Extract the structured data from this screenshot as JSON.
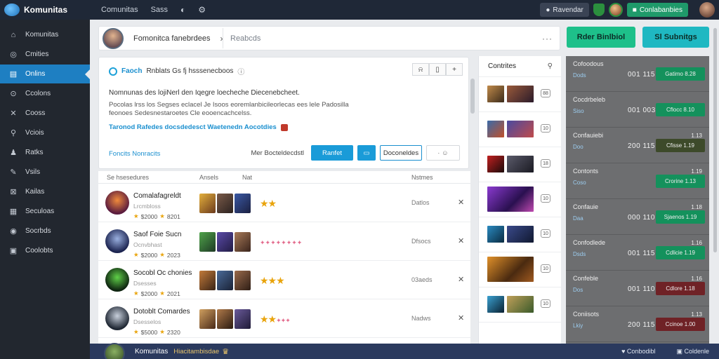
{
  "app": {
    "title": "Komunitas"
  },
  "topnav": {
    "item1": "Comunitas",
    "item2": "Sass"
  },
  "topright": {
    "pill1": "Ravendar",
    "pill2": "Conlabanbies"
  },
  "sidebar": {
    "items": [
      {
        "label": "Komunitas",
        "icon": "home-icon"
      },
      {
        "label": "Cmities",
        "icon": "globe-icon"
      },
      {
        "label": "Onlins",
        "icon": "list-icon",
        "active": true
      },
      {
        "label": "Ccolons",
        "icon": "compass-icon"
      },
      {
        "label": "Cooss",
        "icon": "tools-icon"
      },
      {
        "label": "Vciois",
        "icon": "search-icon"
      },
      {
        "label": "Ratks",
        "icon": "user-icon"
      },
      {
        "label": "Vsils",
        "icon": "puzzle-icon"
      },
      {
        "label": "Kailas",
        "icon": "close-box-icon"
      },
      {
        "label": "Seculoas",
        "icon": "doc-icon"
      },
      {
        "label": "Socrbds",
        "icon": "gauge-icon"
      },
      {
        "label": "Coolobts",
        "icon": "notes-icon"
      }
    ]
  },
  "breadcrumb": {
    "title": "Fomonitca fanebrdees",
    "search_placeholder": "Reabcds"
  },
  "actions": {
    "primary": "Rder Binlbiol",
    "secondary": "Sl Subnitgs"
  },
  "composer": {
    "head_link": "Faoch",
    "head_text": "Rnblats Gs fj hsssenecboos",
    "line1": "Nomnunas des lojiNerl den Iqegre loecheche Diecenebcheet.",
    "line2": "Pocolas lrss los Segses eclacel Je Isoos eoremlanbicileorlecas ees lele Padosilla feonoes Sedesnestaroetes Cle eooencachcelss.",
    "line3": "Taronod Rafedes docsdedesct Waetenedn Aocotdies",
    "link": "Foncits Nonracits",
    "action_label": "Mer Bocteldecdstl",
    "btn_primary": "Ranfet",
    "btn_outline": "Doconeldes"
  },
  "list": {
    "headers": {
      "col1": "Se hsesedures",
      "col2": "Ansels",
      "col3": "Nat",
      "col4": "Nstmes"
    },
    "rows": [
      {
        "name": "Comalafagreldt",
        "sub": "Lrcmbloss",
        "score": "$2000",
        "score2": "8201",
        "status": "Datlos",
        "stars": "gold"
      },
      {
        "name": "Saof Foie Sucn",
        "sub": "Ocnvbhast",
        "score": "$2000",
        "score2": "2023",
        "status": "Dfsocs",
        "stars": "pink"
      },
      {
        "name": "Socobl Oc chonies",
        "sub": "Dsesses",
        "score": "$2000",
        "score2": "2021",
        "status": "03aeds",
        "stars": "gold"
      },
      {
        "name": "Dotoblt Comardes",
        "sub": "Dsesselos",
        "score": "$5000",
        "score2": "2320",
        "status": "Nadws",
        "stars": "gold"
      }
    ]
  },
  "contents": {
    "title": "Contrites",
    "badges": [
      "88",
      "10",
      "18",
      "10",
      "10",
      "10",
      "10"
    ]
  },
  "stats": {
    "rows": [
      {
        "title": "Cofoodous",
        "sub": "Dods",
        "val": "001 115",
        "num": "",
        "btn": "Gatimo 8.28",
        "color": "green"
      },
      {
        "title": "Cocdrbeleb",
        "sub": "Siso",
        "val": "001 003",
        "num": "",
        "btn": "Cflocc 8.10",
        "color": "green"
      },
      {
        "title": "Confauiebi",
        "sub": "Doo",
        "val": "200 115",
        "num": "1.13",
        "btn": "Cfisse 1.19",
        "color": "olive"
      },
      {
        "title": "Contonts",
        "sub": "Coso",
        "val": "",
        "num": "1.19",
        "btn": "Crorine 1.13",
        "color": "green"
      },
      {
        "title": "Confauie",
        "sub": "Daa",
        "val": "000 110",
        "num": "1.18",
        "btn": "Sjaenos 1.19",
        "color": "green"
      },
      {
        "title": "Confodlede",
        "sub": "Dsds",
        "val": "001 115",
        "num": "1.16",
        "btn": "Cdlicie 1.19",
        "color": "green"
      },
      {
        "title": "Confeble",
        "sub": "Dos",
        "val": "001 110",
        "num": "1.16",
        "btn": "Cdlore 1.18",
        "color": "red"
      },
      {
        "title": "Coniisots",
        "sub": "Lkiy",
        "val": "200 115",
        "num": "1.13",
        "btn": "Ccinoe 1.00",
        "color": "red"
      }
    ]
  },
  "bottombar": {
    "name": "Komunitas",
    "sub": "Hiacitambisdae",
    "right1": "Conbodibl",
    "right2": "Coldenle"
  }
}
